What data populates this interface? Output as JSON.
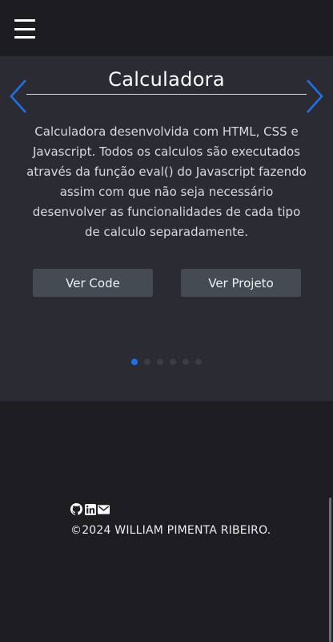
{
  "header": {
    "menu_icon": "hamburger-menu-icon"
  },
  "carousel": {
    "prev_icon": "chevron-left-icon",
    "next_icon": "chevron-right-icon",
    "accent_color": "#1a73e8",
    "slide": {
      "title": "Calculadora",
      "description": "Calculadora desenvolvida com HTML, CSS e Javascript. Todos os calculos são executados através da função eval() do Javascript fazendo assim com que não seja necessário desenvolver as funcionalidades de cada tipo de calculo separadamente.",
      "code_button": "Ver Code",
      "project_button": "Ver Projeto"
    },
    "slide_count": 6,
    "active_index": 0
  },
  "footer": {
    "icons": [
      "github-icon",
      "linkedin-icon",
      "mail-icon"
    ],
    "copyright": "©2024 WILLIAM PIMENTA RIBEIRO."
  }
}
